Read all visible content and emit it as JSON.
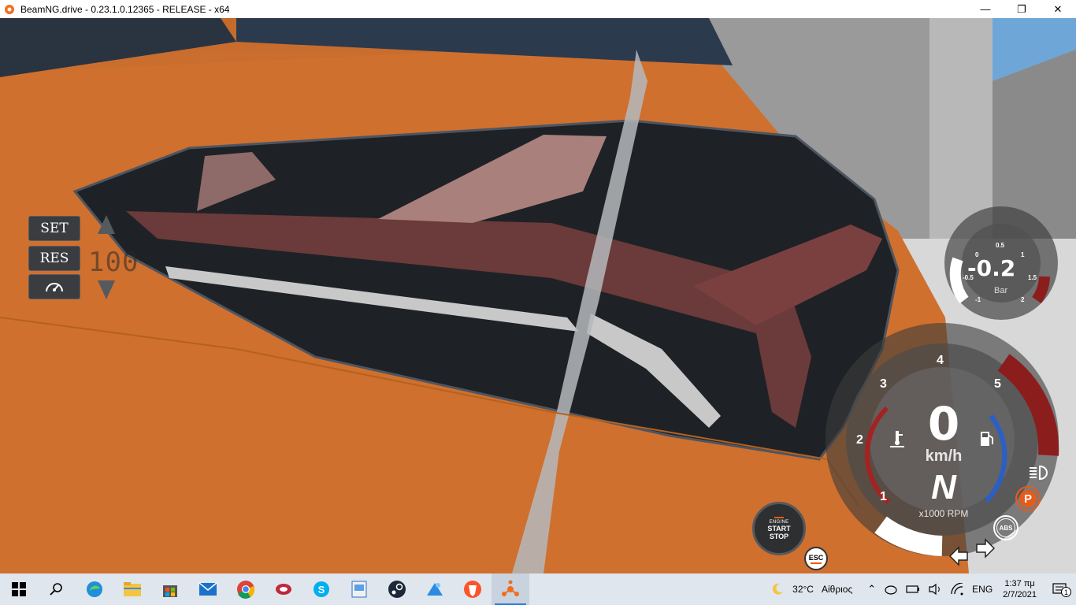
{
  "window": {
    "title": "BeamNG.drive - 0.23.1.0.12365 - RELEASE - x64",
    "icon": "beamng-icon",
    "controls": [
      "minimize-icon",
      "maximize-icon",
      "close-icon"
    ]
  },
  "cruise_control": {
    "set_label": "SET",
    "res_label": "RES",
    "speed": "100",
    "icons": [
      "cruise-speedometer-icon",
      "speed-up-arrow-icon",
      "speed-down-arrow-icon"
    ]
  },
  "boost_gauge": {
    "value": "-0.2",
    "unit": "Bar",
    "ticks": [
      "0",
      "0.5",
      "1",
      "1.5",
      "2",
      "-1",
      "-0.5"
    ]
  },
  "dashboard": {
    "speed": "0",
    "speed_unit": "km/h",
    "gear": "N",
    "rpm_label": "x1000 RPM",
    "rpm_ticks": [
      "1",
      "2",
      "3",
      "4",
      "5"
    ],
    "indicators": [
      "coolant-temperature-icon",
      "fuel-pump-icon",
      "headlight-icon",
      "parking-brake-icon",
      "abs-icon",
      "turn-left-arrow-icon",
      "turn-right-arrow-icon"
    ],
    "parking_label": "P",
    "abs_label": "ABS"
  },
  "engine_button": {
    "line1": "ENGINE",
    "line2": "START",
    "line3": "STOP"
  },
  "esc_button": {
    "label": "ESC"
  },
  "taskbar": {
    "apps": [
      "windows-start-icon",
      "search-icon",
      "edge-icon",
      "file-explorer-icon",
      "store-icon",
      "mail-icon",
      "chrome-icon",
      "app-red-icon",
      "skype-icon",
      "photos-icon",
      "steam-icon",
      "app-blue-icon",
      "brave-icon",
      "beamng-taskbar-icon"
    ],
    "weather_temp": "32°C",
    "weather_desc": "Αίθριος",
    "language": "ENG",
    "time": "1:37 πμ",
    "date": "2/7/2021",
    "notification_count": "1"
  },
  "colors": {
    "car_orange": "#d97a34",
    "gauge_red": "#8c1d1d",
    "gauge_blue": "#2a5fc7",
    "accent_orange": "#e65a1a"
  }
}
